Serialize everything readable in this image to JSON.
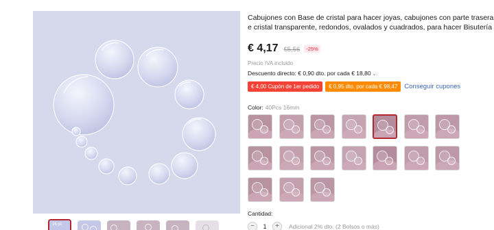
{
  "product": {
    "title_line1": "Cabujones con Base de cristal para hacer joyas, cabujones con parte trasera plana de",
    "title_line2": "e cristal transparente, redondos, ovalados y cuadrados, para hacer Bisutería"
  },
  "pricing": {
    "price": "€ 4,17",
    "old_price": "€5,56",
    "discount_badge": "-25%",
    "tax_note": "Precio IVA incluido",
    "direct_discount": "Descuento directo: € 0,90 dto. por cada € 18,80"
  },
  "coupons": {
    "first_order": "€ 4,00 Cupón de 1er pedido",
    "store": "€ 0,95 dto. por cada € 98,47",
    "get_link": "Conseguir cupones"
  },
  "variant": {
    "label": "Color:",
    "selected_value": "40Pcs 16mm",
    "swatch_count": 17,
    "selected_index": 4
  },
  "quantity": {
    "label": "Cantidad:",
    "value": "1",
    "minus": "−",
    "plus": "+",
    "note": "Adicional 2% dto. (2 Bolsos o más)"
  },
  "thumbnails": {
    "count": 6,
    "selected_index": 0,
    "first_label": "16 pc"
  },
  "colors": {
    "accent_red": "#b3272e",
    "coupon_red": "#f44336",
    "coupon_orange": "#fd8a00",
    "link_blue": "#3a66b7",
    "gallery_bg": "#d6d8ec"
  }
}
